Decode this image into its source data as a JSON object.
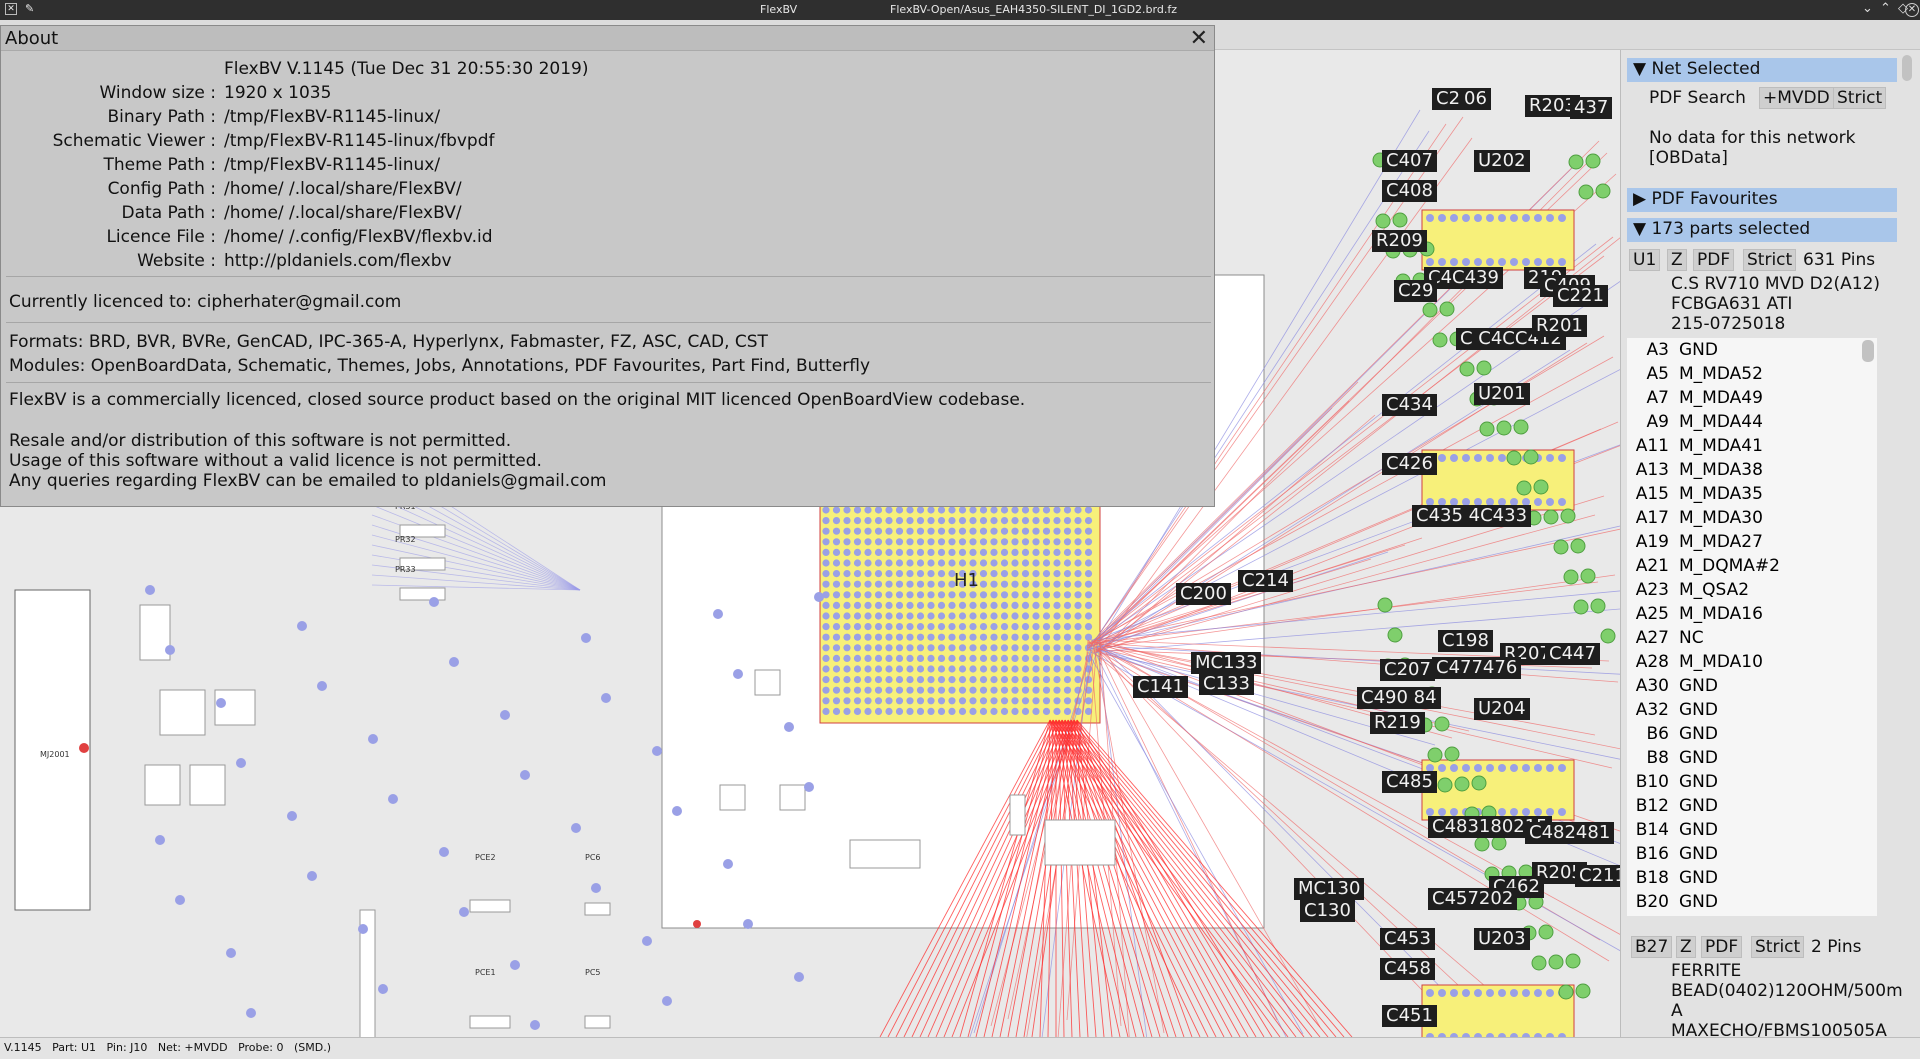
{
  "window": {
    "title": "FlexBV",
    "file": "FlexBV-Open/Asus_EAH4350-SILENT_DI_1GD2.brd.fz"
  },
  "about": {
    "title": "About",
    "close": "✕",
    "rows": [
      {
        "key": "",
        "value": "FlexBV V.1145 (Tue Dec 31 20:55:30 2019)"
      },
      {
        "key": "Window size :",
        "value": "1920 x 1035"
      },
      {
        "key": "Binary Path :",
        "value": "/tmp/FlexBV-R1145-linux/"
      },
      {
        "key": "Schematic Viewer :",
        "value": "/tmp/FlexBV-R1145-linux/fbvpdf"
      },
      {
        "key": "Theme Path :",
        "value": "/tmp/FlexBV-R1145-linux/"
      },
      {
        "key": "Config Path :",
        "value": "/home/              /.local/share/FlexBV/"
      },
      {
        "key": "Data Path :",
        "value": "/home/              /.local/share/FlexBV/"
      },
      {
        "key": "Licence File :",
        "value": "/home/              /.config/FlexBV/flexbv.id"
      },
      {
        "key": "Website :",
        "value": "http://pldaniels.com/flexbv"
      }
    ],
    "licenced_to": "Currently licenced to: cipherhater@gmail.com",
    "formats": "Formats: BRD, BVR, BVRe, GenCAD, IPC-365-A, Hyperlynx, Fabmaster, FZ, ASC, CAD, CST",
    "modules": "Modules: OpenBoardData, Schematic, Themes, Jobs, Annotations, PDF Favourites, Part Find, Butterfly",
    "notice": "FlexBV is a commercially licenced, closed source product based on the original MIT licenced OpenBoardView codebase.",
    "resale": "Resale and/or distribution of this software is not permitted.",
    "usage": "Usage of this software without a valid licence is not permitted.",
    "queries": "Any queries regarding FlexBV can be emailed to pldaniels@gmail.com"
  },
  "panel": {
    "net_selected": {
      "header": "Net Selected",
      "pdf_search": "PDF Search",
      "net": "+MVDD",
      "strict": "Strict",
      "no_data": "No data for this network",
      "obdata": "[OBData]"
    },
    "pdf_favourites": "PDF Favourites",
    "parts_selected": "173 parts selected",
    "part1": {
      "name": "U1",
      "z": "Z",
      "pdf": "PDF",
      "strict": "Strict",
      "pins": "631 Pins",
      "desc": [
        "C.S RV710 MVD D2(A12)",
        "FCBGA631 ATI",
        "215-0725018"
      ]
    },
    "pins": [
      {
        "pin": "A3",
        "net": "GND"
      },
      {
        "pin": "A5",
        "net": "M_MDA52"
      },
      {
        "pin": "A7",
        "net": "M_MDA49"
      },
      {
        "pin": "A9",
        "net": "M_MDA44"
      },
      {
        "pin": "A11",
        "net": "M_MDA41"
      },
      {
        "pin": "A13",
        "net": "M_MDA38"
      },
      {
        "pin": "A15",
        "net": "M_MDA35"
      },
      {
        "pin": "A17",
        "net": "M_MDA30"
      },
      {
        "pin": "A19",
        "net": "M_MDA27"
      },
      {
        "pin": "A21",
        "net": "M_DQMA#2"
      },
      {
        "pin": "A23",
        "net": "M_QSA2"
      },
      {
        "pin": "A25",
        "net": "M_MDA16"
      },
      {
        "pin": "A27",
        "net": "NC"
      },
      {
        "pin": "A28",
        "net": "M_MDA10"
      },
      {
        "pin": "A30",
        "net": "GND"
      },
      {
        "pin": "A32",
        "net": "GND"
      },
      {
        "pin": "B6",
        "net": "GND"
      },
      {
        "pin": "B8",
        "net": "GND"
      },
      {
        "pin": "B10",
        "net": "GND"
      },
      {
        "pin": "B12",
        "net": "GND"
      },
      {
        "pin": "B14",
        "net": "GND"
      },
      {
        "pin": "B16",
        "net": "GND"
      },
      {
        "pin": "B18",
        "net": "GND"
      },
      {
        "pin": "B20",
        "net": "GND"
      }
    ],
    "part2": {
      "name": "B27",
      "z": "Z",
      "pdf": "PDF",
      "strict": "Strict",
      "pins": "2 Pins",
      "desc": [
        "FERRITE",
        "BEAD(0402)120OHM/500m",
        "A",
        "MAXECHO/FBMS100505A"
      ]
    }
  },
  "board_labels": [
    {
      "id": "C406",
      "text": "C406"
    },
    {
      "id": "C2",
      "text": "C2"
    },
    {
      "id": "R203",
      "text": "R203"
    },
    {
      "id": "437",
      "text": "437"
    },
    {
      "id": "C407",
      "text": "C407"
    },
    {
      "id": "U202",
      "text": "U202"
    },
    {
      "id": "C408",
      "text": "C408"
    },
    {
      "id": "R209",
      "text": "R209"
    },
    {
      "id": "C439",
      "text": "C4C439"
    },
    {
      "id": "219",
      "text": "219"
    },
    {
      "id": "C409",
      "text": "C409"
    },
    {
      "id": "C29",
      "text": "C29"
    },
    {
      "id": "C221",
      "text": "C221"
    },
    {
      "id": "C412",
      "text": "C C4CC412"
    },
    {
      "id": "R201",
      "text": "R201"
    },
    {
      "id": "C434",
      "text": "C434"
    },
    {
      "id": "U201",
      "text": "U201"
    },
    {
      "id": "C426",
      "text": "C426"
    },
    {
      "id": "C433",
      "text": "C435 4C433"
    },
    {
      "id": "C214",
      "text": "C214"
    },
    {
      "id": "C200",
      "text": "C200"
    },
    {
      "id": "C198",
      "text": "C198"
    },
    {
      "id": "R207",
      "text": "R207"
    },
    {
      "id": "C447",
      "text": "C447"
    },
    {
      "id": "C477",
      "text": "C477476"
    },
    {
      "id": "MC133",
      "text": "MC133"
    },
    {
      "id": "C133",
      "text": "C133"
    },
    {
      "id": "C141",
      "text": "C141"
    },
    {
      "id": "C207",
      "text": "C207"
    },
    {
      "id": "C490",
      "text": "C490 84"
    },
    {
      "id": "U204",
      "text": "U204"
    },
    {
      "id": "R219",
      "text": "R219"
    },
    {
      "id": "C485",
      "text": "C485"
    },
    {
      "id": "C483",
      "text": "C483180215"
    },
    {
      "id": "C482",
      "text": "C482481"
    },
    {
      "id": "R205",
      "text": "R205"
    },
    {
      "id": "C211",
      "text": "C211"
    },
    {
      "id": "C462",
      "text": "C462"
    },
    {
      "id": "C457",
      "text": "C457202"
    },
    {
      "id": "MC130",
      "text": "MC130"
    },
    {
      "id": "C130",
      "text": "C130"
    },
    {
      "id": "C453",
      "text": "C453"
    },
    {
      "id": "U203",
      "text": "U203"
    },
    {
      "id": "C458",
      "text": "C458"
    },
    {
      "id": "C451",
      "text": "C451"
    },
    {
      "id": "H1",
      "text": "H1"
    }
  ],
  "board_small_labels": [
    {
      "text": "PR31"
    },
    {
      "text": "PR32"
    },
    {
      "text": "PR33"
    },
    {
      "text": "PCE2"
    },
    {
      "text": "PC6"
    },
    {
      "text": "PCE1"
    },
    {
      "text": "PC5"
    },
    {
      "text": "MJ2001"
    }
  ],
  "status": "V.1145   Part: U1   Pin: J10   Net: +MVDD   Probe: 0   (SMD.)"
}
